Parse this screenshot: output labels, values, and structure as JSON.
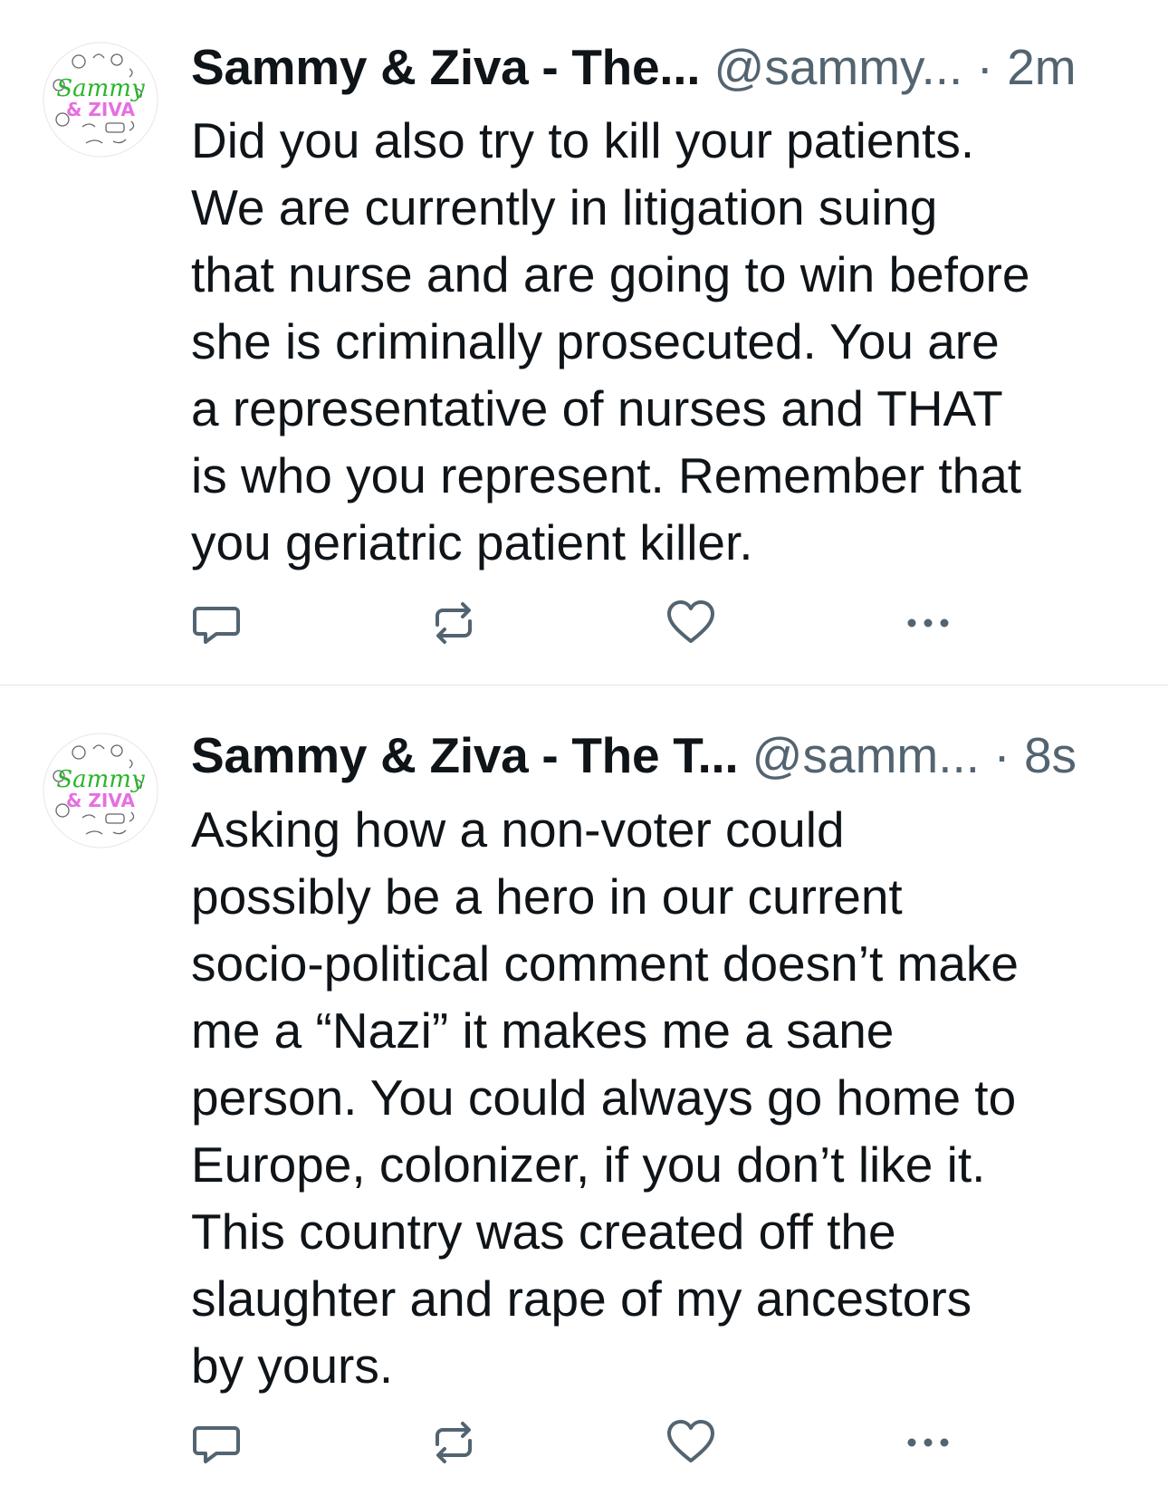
{
  "colors": {
    "text": "#0f1419",
    "secondary": "#536471",
    "divider": "#e1e6ea",
    "avatar_script_green": "#2bb52b",
    "avatar_block_pink": "#e66fe0"
  },
  "tweets": [
    {
      "display_name": "Sammy & Ziva - The...",
      "handle": "@sammy...",
      "separator": "·",
      "time": "2m",
      "text": "Did you also try to kill your patients.\nWe are currently in litigation suing\nthat nurse and are going to win before\nshe is criminally prosecuted. You are\na representative of nurses and THAT\nis who you represent. Remember that\nyou geriatric patient killer.",
      "avatar": {
        "icon": "avatar-sammy-ziva-logo",
        "line1": "Sammy",
        "line2": "& ZIVA"
      },
      "actions": [
        "reply-icon",
        "retweet-icon",
        "like-icon",
        "more-icon"
      ]
    },
    {
      "display_name": "Sammy & Ziva - The T...",
      "handle": "@samm...",
      "separator": "·",
      "time": "8s",
      "text": "Asking how a non-voter could\npossibly be a hero in our current\nsocio-political comment doesn’t make\nme a “Nazi” it makes me a sane\nperson. You could always go home to\nEurope, colonizer, if you don’t like it.\nThis country was created off the\nslaughter and rape of my ancestors\nby yours.",
      "avatar": {
        "icon": "avatar-sammy-ziva-logo",
        "line1": "Sammy",
        "line2": "& ZIVA"
      },
      "actions": [
        "reply-icon",
        "retweet-icon",
        "like-icon",
        "more-icon"
      ]
    }
  ]
}
